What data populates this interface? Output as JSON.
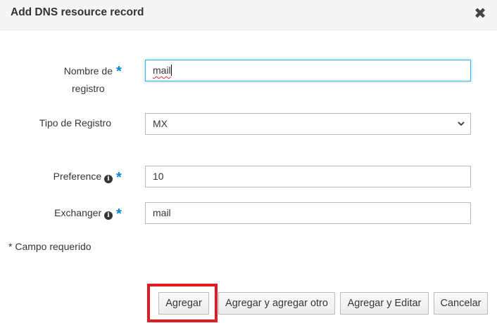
{
  "dialog": {
    "title": "Add DNS resource record",
    "close_glyph": "✖"
  },
  "form": {
    "record_name": {
      "label_line1": "Nombre de",
      "label_line2": "registro",
      "required": "*",
      "value": "mail"
    },
    "record_type": {
      "label": "Tipo de Registro",
      "selected": "MX"
    },
    "preference": {
      "label": "Preference",
      "info_glyph": "i",
      "required": "*",
      "value": "10"
    },
    "exchanger": {
      "label": "Exchanger",
      "info_glyph": "i",
      "required": "*",
      "value": "mail"
    }
  },
  "required_note": "* Campo requerido",
  "buttons": {
    "add": "Agregar",
    "add_another": "Agregar y agregar otro",
    "add_edit": "Agregar y Editar",
    "cancel": "Cancelar"
  },
  "colors": {
    "required_star": "#0088ce",
    "highlight_box": "#e31c24",
    "focus_border": "#3db3e8"
  },
  "icons": [
    "close-icon",
    "chevron-down-icon",
    "info-icon"
  ]
}
